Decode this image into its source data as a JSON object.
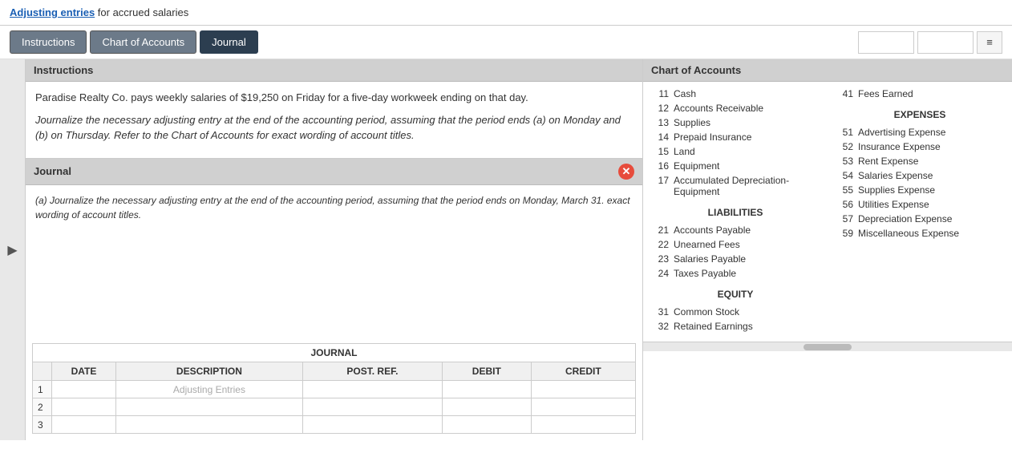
{
  "header": {
    "link_text": "Adjusting entries",
    "title_suffix": " for accrued salaries"
  },
  "tabs": [
    {
      "label": "Instructions",
      "active": false
    },
    {
      "label": "Chart of Accounts",
      "active": false
    },
    {
      "label": "Journal",
      "active": true
    }
  ],
  "toolbar": {
    "input1_value": "",
    "input2_value": "",
    "menu_icon": "≡"
  },
  "instructions": {
    "header": "Instructions",
    "para1": "Paradise Realty Co. pays weekly salaries of $19,250 on Friday for a five-day workweek ending on that day.",
    "para2": "Journalize the necessary adjusting entry at the end of the accounting period, assuming that the period ends (a) on Monday and (b) on Thursday. Refer to the Chart of Accounts for exact wording of account titles."
  },
  "journal": {
    "header": "Journal",
    "content": "(a) Journalize the necessary adjusting entry at the end of the accounting period, assuming that the period ends on Monday, March 31. exact wording of account titles.",
    "table_title": "JOURNAL",
    "columns": [
      "DATE",
      "DESCRIPTION",
      "POST. REF.",
      "DEBIT",
      "CREDIT"
    ],
    "row1_placeholder": "Adjusting Entries",
    "rows": [
      {
        "num": 1,
        "desc_placeholder": "Adjusting Entries"
      },
      {
        "num": 2,
        "desc_placeholder": ""
      },
      {
        "num": 3,
        "desc_placeholder": ""
      }
    ]
  },
  "chart_of_accounts": {
    "header": "Chart of Accounts",
    "left_items": [
      {
        "num": "11",
        "name": "Cash"
      },
      {
        "num": "12",
        "name": "Accounts Receivable"
      },
      {
        "num": "13",
        "name": "Supplies"
      },
      {
        "num": "14",
        "name": "Prepaid Insurance"
      },
      {
        "num": "15",
        "name": "Land"
      },
      {
        "num": "16",
        "name": "Equipment"
      },
      {
        "num": "17",
        "name": "Accumulated Depreciation-Equipment"
      }
    ],
    "liabilities_title": "LIABILITIES",
    "liabilities": [
      {
        "num": "21",
        "name": "Accounts Payable"
      },
      {
        "num": "22",
        "name": "Unearned Fees"
      },
      {
        "num": "23",
        "name": "Salaries Payable"
      },
      {
        "num": "24",
        "name": "Taxes Payable"
      }
    ],
    "equity_title": "EQUITY",
    "equity": [
      {
        "num": "31",
        "name": "Common Stock"
      },
      {
        "num": "32",
        "name": "Retained Earnings"
      }
    ],
    "right_items": [
      {
        "num": "41",
        "name": "Fees Earned"
      }
    ],
    "expenses_title": "EXPENSES",
    "expenses": [
      {
        "num": "51",
        "name": "Advertising Expense"
      },
      {
        "num": "52",
        "name": "Insurance Expense"
      },
      {
        "num": "53",
        "name": "Rent Expense"
      },
      {
        "num": "54",
        "name": "Salaries Expense"
      },
      {
        "num": "55",
        "name": "Supplies Expense"
      },
      {
        "num": "56",
        "name": "Utilities Expense"
      },
      {
        "num": "57",
        "name": "Depreciation Expense"
      },
      {
        "num": "59",
        "name": "Miscellaneous Expense"
      }
    ]
  },
  "colors": {
    "tab_active": "#2c3e50",
    "tab_inactive": "#6c7a89",
    "section_header_bg": "#d0d0d0",
    "close_btn": "#e74c3c"
  }
}
